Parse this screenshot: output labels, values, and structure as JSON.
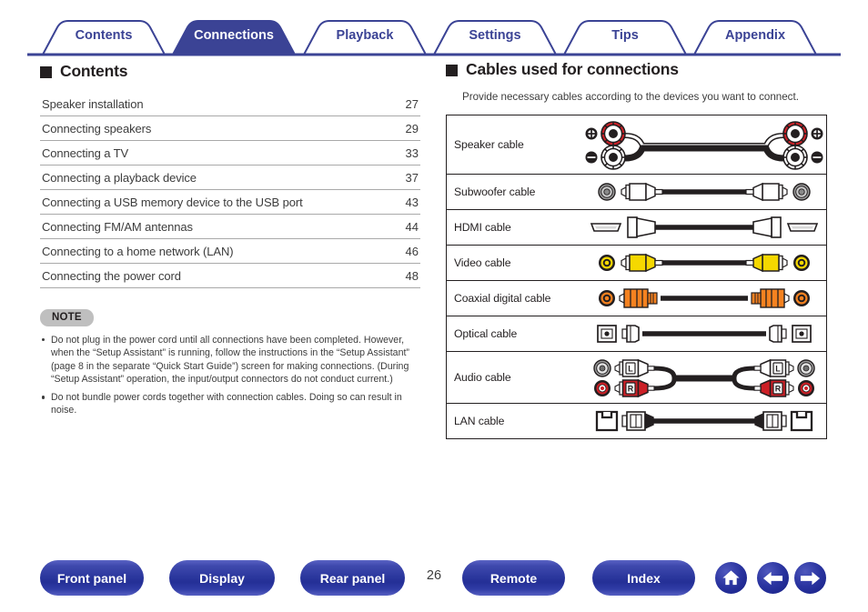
{
  "tabs": [
    {
      "label": "Contents",
      "active": false
    },
    {
      "label": "Connections",
      "active": true
    },
    {
      "label": "Playback",
      "active": false
    },
    {
      "label": "Settings",
      "active": false
    },
    {
      "label": "Tips",
      "active": false
    },
    {
      "label": "Appendix",
      "active": false
    }
  ],
  "left": {
    "heading": "Contents",
    "toc": [
      {
        "title": "Speaker installation",
        "page": "27"
      },
      {
        "title": "Connecting speakers",
        "page": "29"
      },
      {
        "title": "Connecting a TV",
        "page": "33"
      },
      {
        "title": "Connecting a playback device",
        "page": "37"
      },
      {
        "title": "Connecting a USB memory device to the USB port",
        "page": "43"
      },
      {
        "title": "Connecting FM/AM antennas",
        "page": "44"
      },
      {
        "title": "Connecting to a home network (LAN)",
        "page": "46"
      },
      {
        "title": "Connecting the power cord",
        "page": "48"
      }
    ],
    "note": {
      "label": "NOTE",
      "items": [
        "Do not plug in the power cord until all connections have been completed. However, when the “Setup Assistant” is running, follow the instructions in the “Setup Assistant” (page 8 in the separate “Quick Start Guide”) screen for making connections. (During “Setup Assistant” operation, the input/output connectors do not conduct current.)",
        "Do not bundle power cords together with connection cables. Doing so can result in noise."
      ]
    }
  },
  "right": {
    "heading": "Cables used for connections",
    "description": "Provide necessary cables according to the devices you want to connect.",
    "cables": [
      {
        "label": "Speaker cable",
        "art": "speaker"
      },
      {
        "label": "Subwoofer cable",
        "art": "rca-gray"
      },
      {
        "label": "HDMI cable",
        "art": "hdmi"
      },
      {
        "label": "Video cable",
        "art": "yellow"
      },
      {
        "label": "Coaxial digital cable",
        "art": "orange"
      },
      {
        "label": "Optical cable",
        "art": "optical"
      },
      {
        "label": "Audio cable",
        "art": "audio-lr"
      },
      {
        "label": "LAN cable",
        "art": "lan"
      }
    ]
  },
  "footer": {
    "buttons": [
      {
        "label": "Front panel"
      },
      {
        "label": "Display"
      },
      {
        "label": "Rear panel"
      },
      {
        "label": "Remote"
      },
      {
        "label": "Index"
      }
    ],
    "page_number": "26",
    "icons": [
      {
        "name": "home-icon"
      },
      {
        "name": "arrow-left-icon"
      },
      {
        "name": "arrow-right-icon"
      }
    ]
  },
  "colors": {
    "brand_blue": "#3b4395",
    "active_tab_fill": "#3b4395",
    "rule_gray": "#a9a9a9",
    "note_pill": "#bfbfbf",
    "ink": "#231f20",
    "red": "#cc2027",
    "yellow": "#f5d800",
    "orange": "#f58220"
  }
}
